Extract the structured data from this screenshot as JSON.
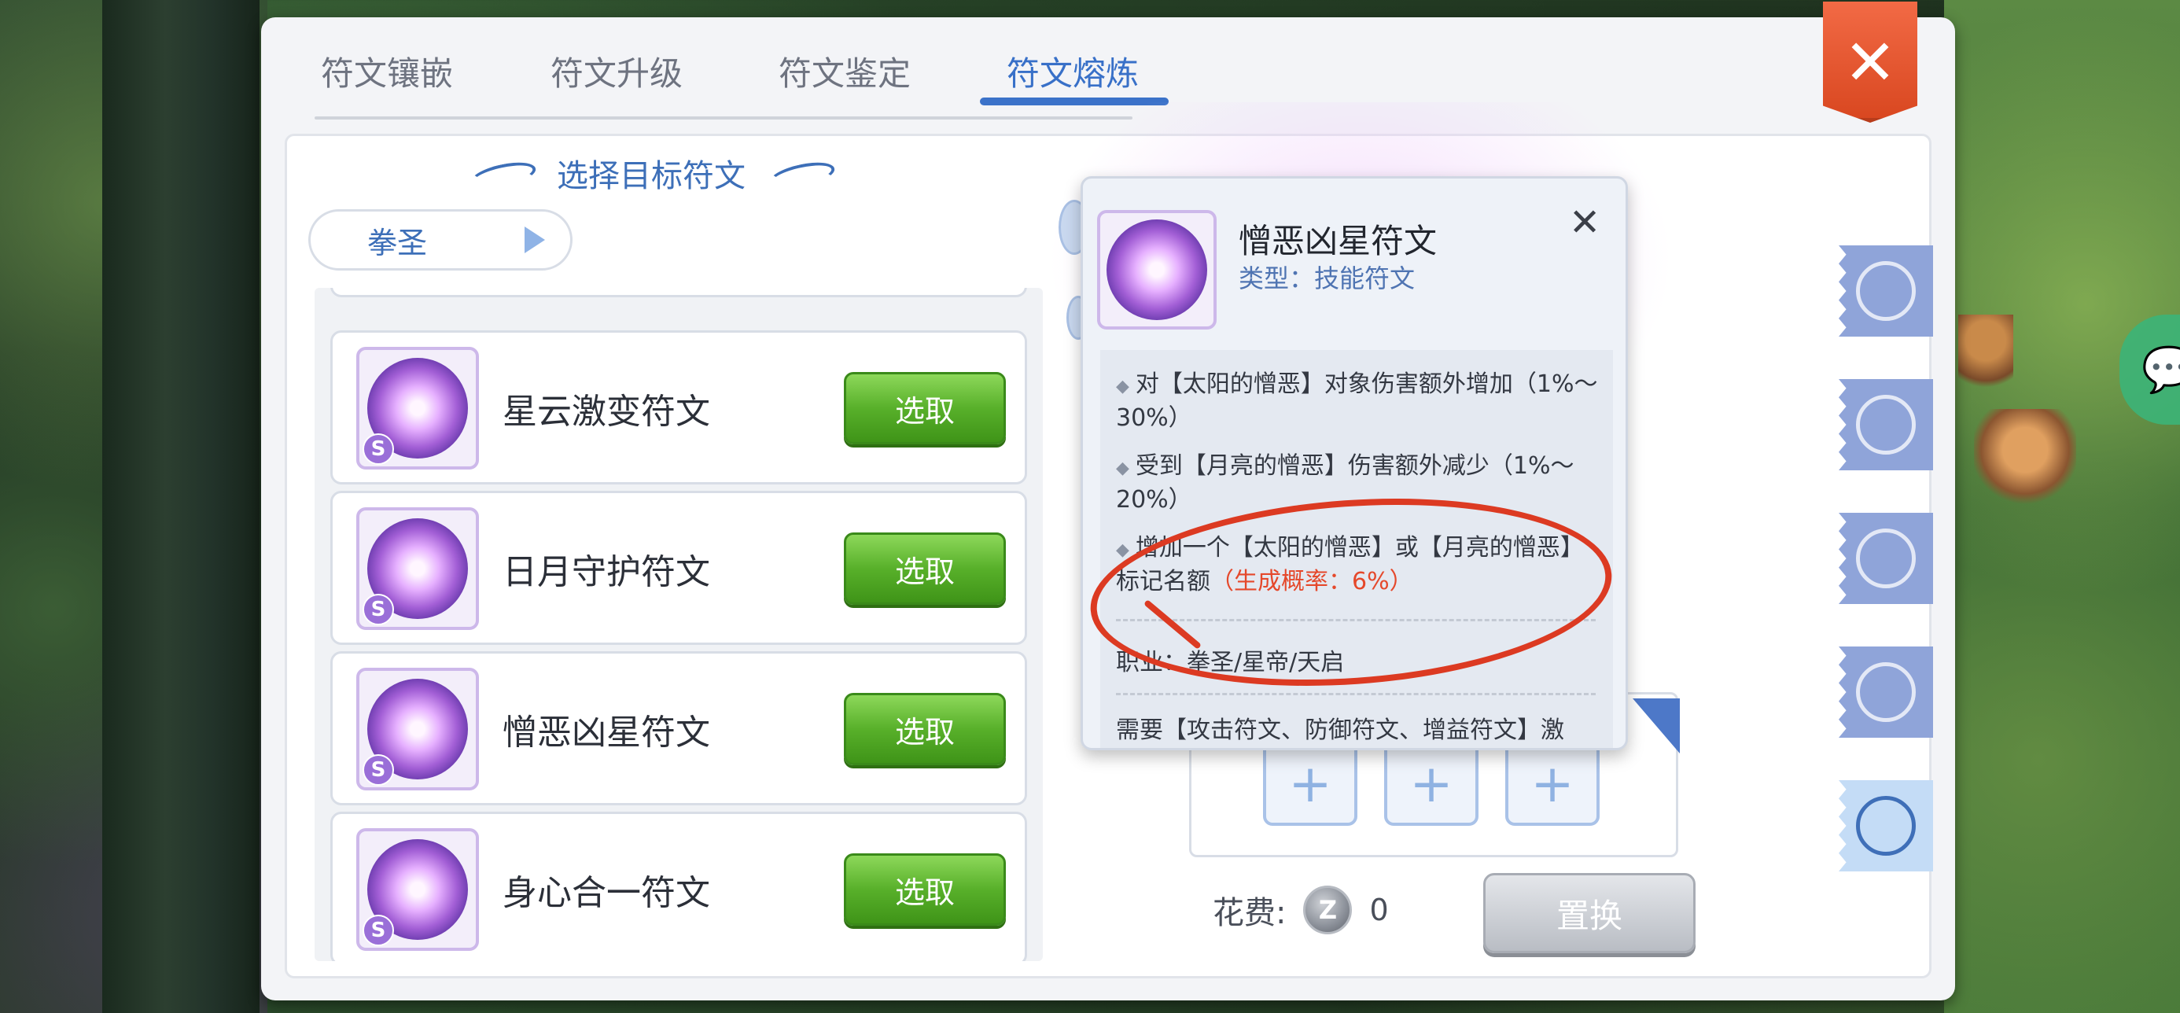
{
  "tabs": [
    {
      "label": "符文镶嵌",
      "active": false
    },
    {
      "label": "符文升级",
      "active": false
    },
    {
      "label": "符文鉴定",
      "active": false
    },
    {
      "label": "符文熔炼",
      "active": true
    }
  ],
  "close_icon": "close-icon",
  "left_panel": {
    "title": "选择目标符文",
    "class_select": "拳圣",
    "items": [
      {
        "name": "星云激变符文",
        "grade": "S",
        "button": "选取"
      },
      {
        "name": "日月守护符文",
        "grade": "S",
        "button": "选取"
      },
      {
        "name": "憎恶凶星符文",
        "grade": "S",
        "button": "选取"
      },
      {
        "name": "身心合一符文",
        "grade": "S",
        "button": "选取"
      }
    ]
  },
  "tooltip": {
    "name": "憎恶凶星符文",
    "type": "类型：技能符文",
    "effects": [
      {
        "text": "对【太阳的憎恶】对象伤害额外增加（1%～30%）"
      },
      {
        "text": "受到【月亮的憎恶】伤害额外减少（1%～20%）"
      },
      {
        "text": "增加一个【太阳的憎恶】或【月亮的憎恶】标记名额",
        "prob": "（生成概率：6%）"
      }
    ],
    "job": "职业：拳圣/星帝/天启",
    "need": "需要【攻击符文、防御符文、增益符文】激"
  },
  "slots": [
    "+",
    "+",
    "+"
  ],
  "cost": {
    "label": "花费:",
    "coin": "Z",
    "amount": "0"
  },
  "replace_button": "置换",
  "colors": {
    "accent": "#3b72c9",
    "annotation": "#dc3a22",
    "button_green": "#58b02a",
    "probability": "#e5482b"
  }
}
